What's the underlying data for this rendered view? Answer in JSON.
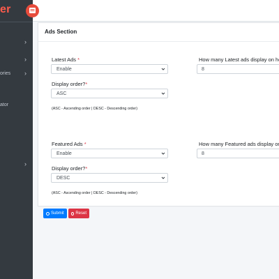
{
  "brand": {
    "text": "er",
    "color": "#ff5b4c"
  },
  "sidebar": {
    "items": [
      {
        "label": "",
        "has_chevron": true
      },
      {
        "label": "",
        "has_chevron": true
      },
      {
        "label": "ories",
        "has_chevron": true
      },
      {
        "label": "ator",
        "has_chevron": false
      },
      {
        "label": "",
        "has_chevron": true
      }
    ]
  },
  "section": {
    "title": "Ads Section"
  },
  "latest": {
    "ads_label": "Latest Ads",
    "ads_required": "*",
    "ads_value": "Enable",
    "count_label": "How many Latest ads display on homep",
    "count_value": "8",
    "order_label": "Display order?",
    "order_required": "*",
    "order_value": "ASC",
    "help": "(ASC - Ascending order | DESC - Descending order)"
  },
  "featured": {
    "ads_label": "Featured Ads",
    "ads_required": "*",
    "ads_value": "Enable",
    "count_label": "How many Featured ads display on hom",
    "count_value": "8",
    "order_label": "Display order?",
    "order_required": "*",
    "order_value": "DESC",
    "help": "(ASC - Ascending order | DESC - Descending order)"
  },
  "actions": {
    "submit": "Submit",
    "reset": "Reset"
  },
  "colors": {
    "submit": "#007bff",
    "reset": "#dc3545",
    "sidebar": "#343a40",
    "toggle": "#e74c3c"
  }
}
